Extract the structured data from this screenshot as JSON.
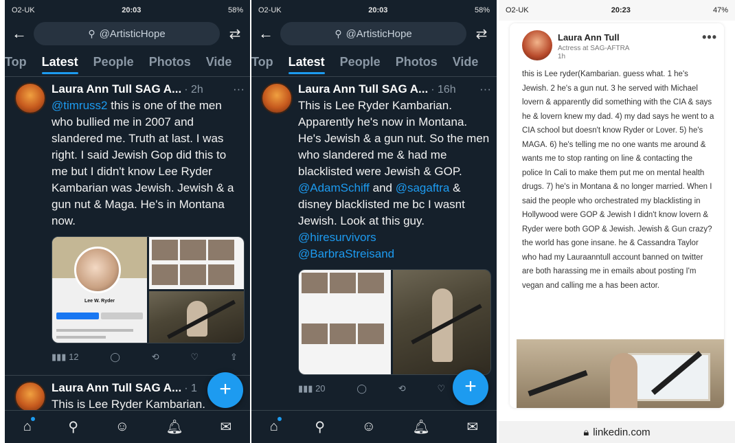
{
  "panel1": {
    "status": {
      "left": "O2-UK",
      "time": "20:03",
      "battery": "58%"
    },
    "search_value": "@ArtisticHope",
    "tabs": [
      "Top",
      "Latest",
      "People",
      "Photos",
      "Vide"
    ],
    "tweet1": {
      "name": "Laura Ann Tull SAG A...",
      "time": "· 2h",
      "more": "···",
      "mention": "@timruss2",
      "text": " this is one of the men who bullied me in 2007 and slandered me.  Truth at last.  I was right.  I said Jewish Gop did this to me but I didn't know Lee Ryder Kambarian was Jewish.  Jewish & a gun nut & Maga.  He's in Montana now.",
      "fb_name": "Lee W. Ryder",
      "views": "12"
    },
    "tweet2": {
      "name": "Laura Ann Tull SAG A...",
      "time": "· 1",
      "text": "This is Lee Ryder Kambarian."
    }
  },
  "panel2": {
    "status": {
      "left": "O2-UK",
      "time": "20:03",
      "battery": "58%"
    },
    "search_value": "@ArtisticHope",
    "tabs": [
      "Top",
      "Latest",
      "People",
      "Photos",
      "Vide"
    ],
    "tweet1": {
      "name": "Laura Ann Tull SAG A...",
      "time": "· 16h",
      "more": "···",
      "text_a": "This is Lee Ryder Kambarian. Apparently he's now in Montana.  He's Jewish & a gun nut.  So the men who slandered me & had me blacklisted were Jewish & GOP. ",
      "mention_a": "@AdamSchiff",
      "text_b": " and ",
      "mention_b": "@sagaftra",
      "text_c": " & disney blacklisted me bc I wasnt Jewish.  Look at this guy. ",
      "mention_c": "@hiresurvivors",
      "mention_d": "@BarbraStreisand",
      "views": "20"
    }
  },
  "panel3": {
    "status": {
      "left": "O2-UK",
      "time": "20:23",
      "battery": "47%"
    },
    "post": {
      "name": "Laura Ann Tull",
      "subtitle": "Actress at SAG-AFTRA",
      "time": "1h",
      "more": "•••",
      "text": "this is Lee ryder(Kambarian.  guess what.  1 he's Jewish.  2 he's a gun nut.  3 he served with Michael lovern & apparently did something with the CIA & says he & lovern knew my dad.  4) my dad says he went to a CIA school but doesn't know Ryder or Lover.  5) he's MAGA.  6) he's telling me no one wants me around & wants me to stop ranting on line & contacting the police In Cali to make them put me on mental health drugs.  7) he's in Montana & no longer married.  When I said the people who orchestrated my blacklisting in Hollywood were GOP & Jewish I didn't know lovern & Ryder were both GOP & Jewish.  Jewish & Gun crazy?  the world has gone insane.  he & Cassandra Taylor who had my Lauraanntull account banned on twitter are both harassing me in emails about posting I'm vegan and calling me a has been actor."
    },
    "url": "linkedin.com"
  },
  "colors": {
    "twitter_bg": "#15202b",
    "accent": "#1d9bf0",
    "linkedin_bg": "#ffffff"
  },
  "icons": {
    "back": "back-arrow-icon",
    "search": "search-icon",
    "filter": "filter-icon",
    "plus": "plus-icon",
    "home": "home-icon",
    "spaces": "spaces-icon",
    "bell": "bell-icon",
    "mail": "mail-icon",
    "lock": "lock-icon"
  }
}
